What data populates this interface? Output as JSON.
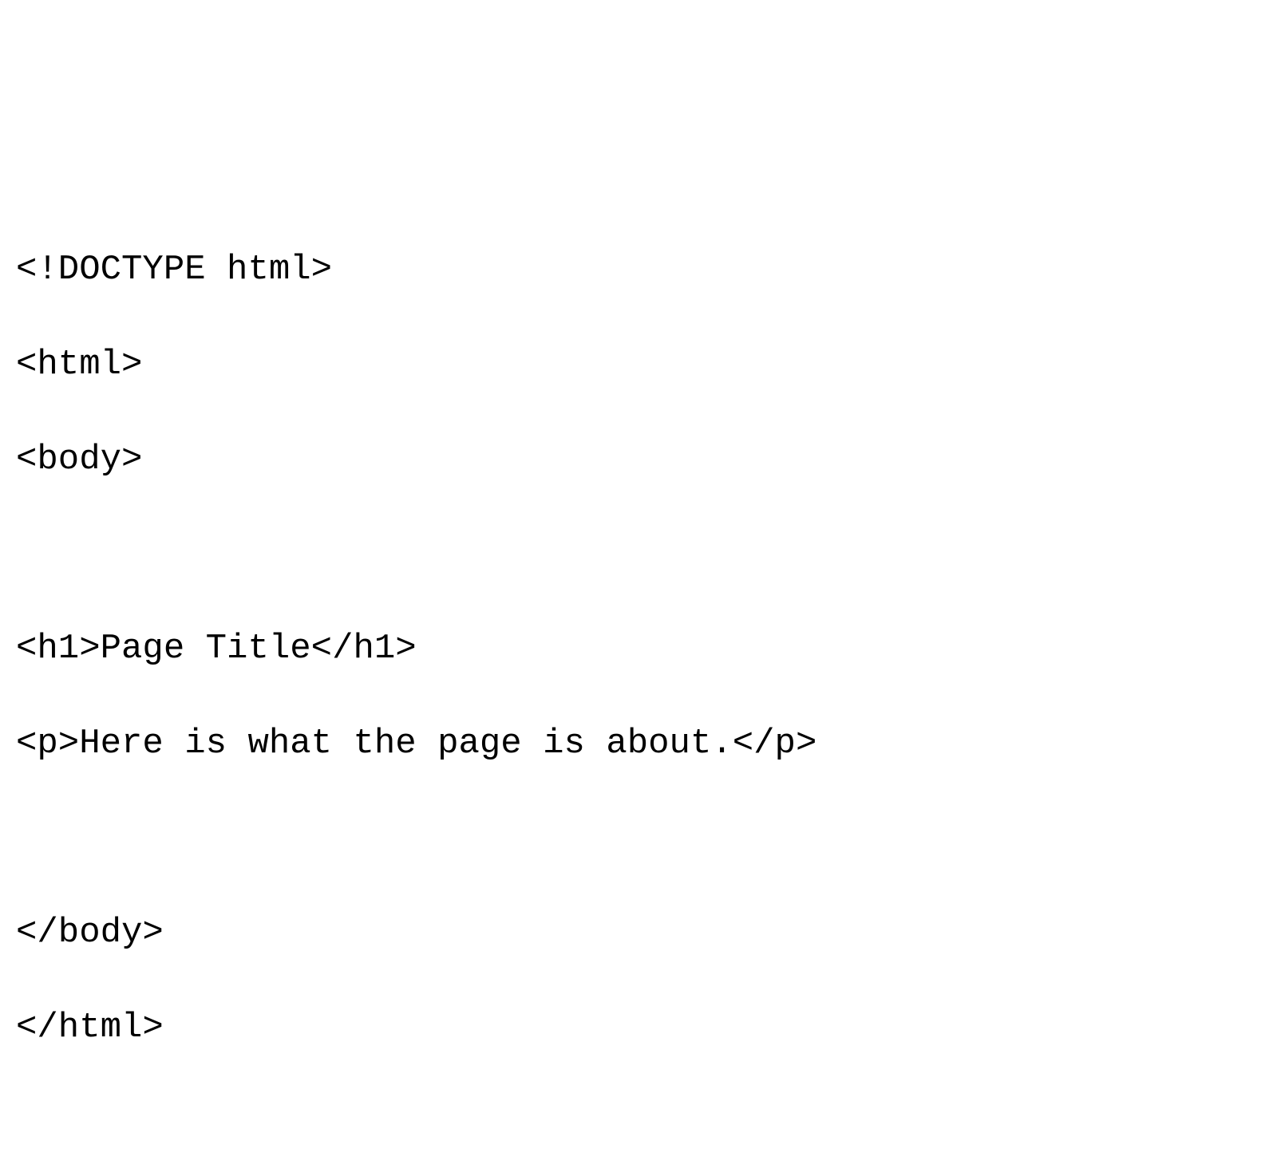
{
  "code": {
    "lines": [
      "<!DOCTYPE html>",
      "<html>",
      "<body>",
      "",
      "<h1>Page Title</h1>",
      "<p>Here is what the page is about.</p>",
      "",
      "</body>",
      "</html>"
    ]
  }
}
